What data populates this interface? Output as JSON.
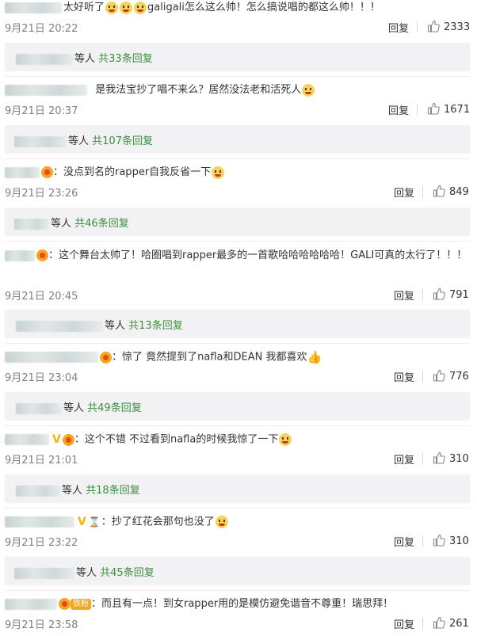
{
  "comments": [
    {
      "text_a": "太好听了",
      "text_b": "galigali怎么这么帅！怎么搞说唱的都这么帅！！！",
      "date": "9月21日 20:22",
      "reply_label": "回复",
      "likes": "2333",
      "sub": {
        "who": "等人",
        "count_text": "共33条回复"
      }
    },
    {
      "text": "是我法宝抄了唱不来么？居然没法老和活死人",
      "date": "9月21日 20:37",
      "reply_label": "回复",
      "likes": "1671",
      "sub": {
        "who": "等人",
        "count_text": "共107条回复"
      }
    },
    {
      "text": "：没点到名的rapper自我反省一下",
      "date": "9月21日 23:26",
      "reply_label": "回复",
      "likes": "849",
      "sub": {
        "who": "等人",
        "count_text": "共46条回复"
      }
    },
    {
      "text": "：这个舞台太帅了！哈圈唱到rapper最多的一首歌哈哈哈哈哈哈！GALI可真的太行了！！！",
      "date": "9月21日 20:45",
      "reply_label": "回复",
      "likes": "791",
      "sub": {
        "who": "等人",
        "count_text": "共13条回复"
      }
    },
    {
      "text": "：惊了 竟然提到了nafla和DEAN 我都喜欢",
      "date": "9月21日 23:04",
      "reply_label": "回复",
      "likes": "776",
      "sub": {
        "who": "等人",
        "count_text": "共49条回复"
      }
    },
    {
      "text": "：这个不错 不过看到nafla的时候我惊了一下",
      "date": "9月21日 21:01",
      "reply_label": "回复",
      "likes": "310",
      "sub": {
        "who": "等人",
        "count_text": "共18条回复"
      }
    },
    {
      "text": "：抄了红花会那句也没了",
      "date": "9月21日 23:22",
      "reply_label": "回复",
      "likes": "310",
      "sub": {
        "who": "等人",
        "count_text": "共45条回复"
      }
    },
    {
      "badge_text": "铁粉",
      "text": "：而且有一点！到女rapper用的是模仿避免谐音不尊重！瑞思拜！",
      "date": "9月21日 23:58",
      "reply_label": "回复",
      "likes": "261"
    }
  ]
}
